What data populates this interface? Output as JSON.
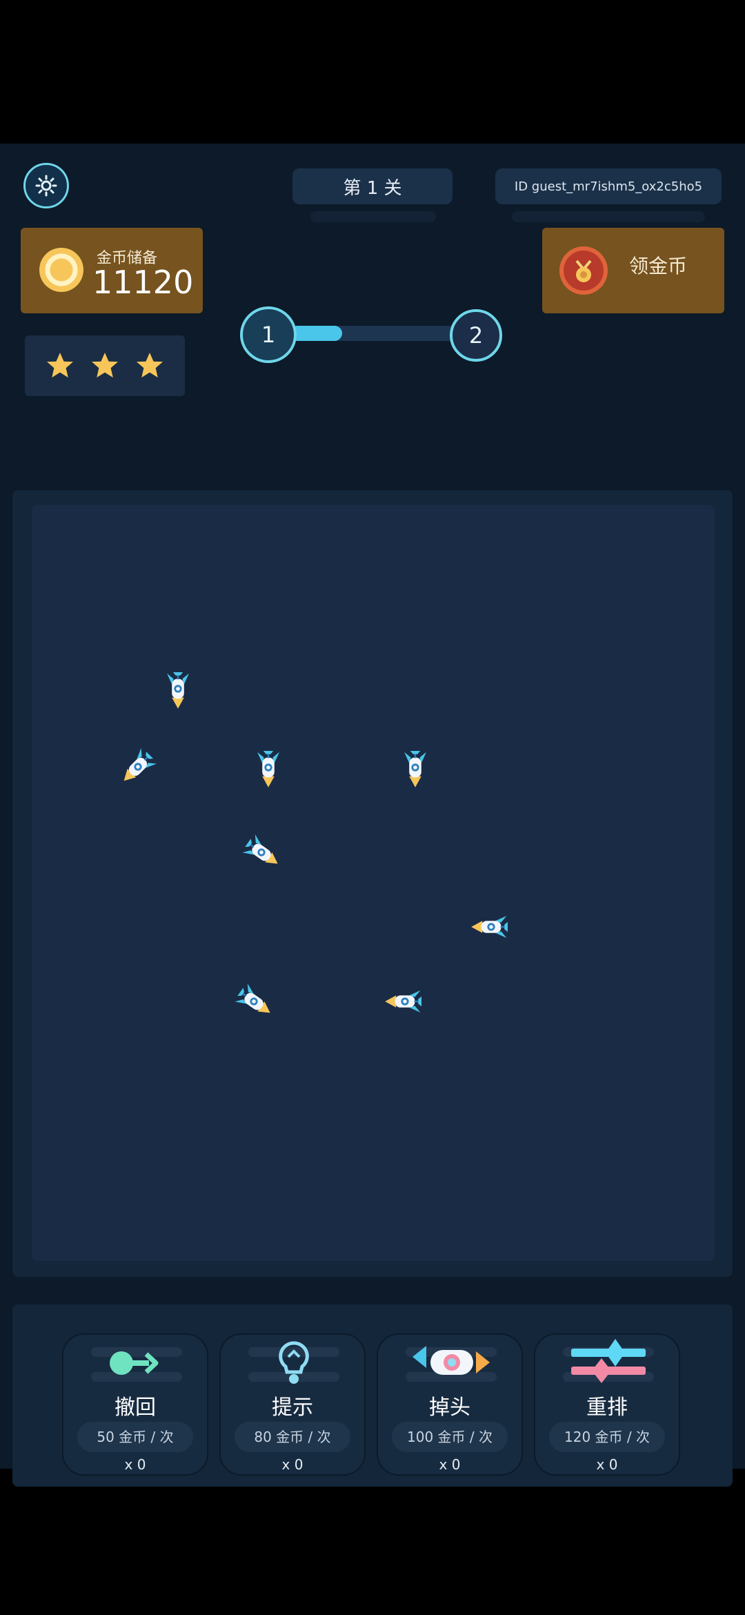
{
  "header": {
    "level_label": "第 1 关",
    "player_id": "ID guest_mr7ishm5_ox2c5ho5",
    "settings_icon": "gear-icon"
  },
  "coins": {
    "label": "金币储备",
    "value": "11120",
    "icon": "coin-icon"
  },
  "reward": {
    "label": "领金币",
    "icon": "medal-icon"
  },
  "stars": {
    "earned": 3,
    "total": 3,
    "icon": "star-icon"
  },
  "progress": {
    "current_node": "1",
    "next_node": "2",
    "fraction": 0.3
  },
  "board": {
    "rocket_icon": "rocket-icon",
    "rocket_count": 8
  },
  "tools": [
    {
      "name": "撤回",
      "cost": "50 金币 / 次",
      "count": "x 0",
      "icon": "undo-arrow-icon"
    },
    {
      "name": "提示",
      "cost": "80 金币 / 次",
      "count": "x 0",
      "icon": "lightbulb-icon"
    },
    {
      "name": "掉头",
      "cost": "100 金币 / 次",
      "count": "x 0",
      "icon": "flip-direction-icon"
    },
    {
      "name": "重排",
      "cost": "120 金币 / 次",
      "count": "x 0",
      "icon": "shuffle-sliders-icon"
    }
  ],
  "colors": {
    "accent": "#49c6ea",
    "gold": "#f7c65a",
    "card_brown": "#76531f",
    "board": "#1a2b45"
  }
}
